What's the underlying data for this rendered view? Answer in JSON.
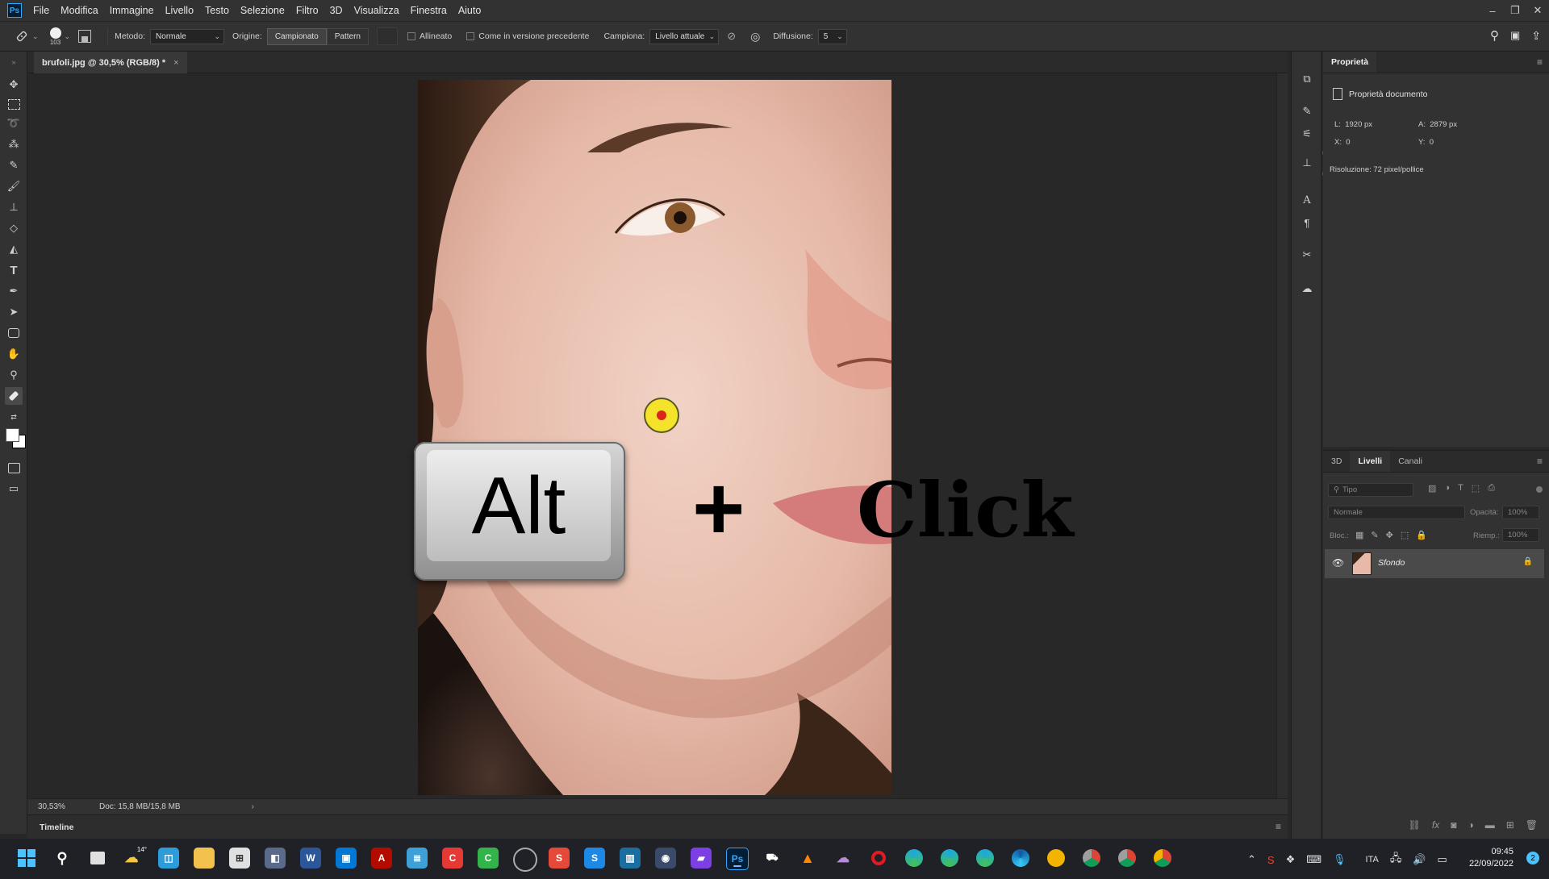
{
  "menubar": {
    "logo": "Ps",
    "items": [
      "File",
      "Modifica",
      "Immagine",
      "Livello",
      "Testo",
      "Selezione",
      "Filtro",
      "3D",
      "Visualizza",
      "Finestra",
      "Aiuto"
    ],
    "window_controls": [
      "–",
      "❐",
      "✕"
    ]
  },
  "options": {
    "brush_size": "103",
    "metodo_label": "Metodo:",
    "metodo_value": "Normale",
    "origine_label": "Origine:",
    "origine_campionato": "Campionato",
    "origine_pattern": "Pattern",
    "allineato_label": "Allineato",
    "precedente_label": "Come in versione precedente",
    "campiona_label": "Campiona:",
    "campiona_value": "Livello attuale",
    "diffusione_label": "Diffusione:",
    "diffusione_value": "5"
  },
  "document": {
    "tab_title": "brufoli.jpg @ 30,5% (RGB/8) *",
    "tab_close": "×",
    "zoom": "30,53%",
    "doc_info": "Doc: 15,8 MB/15,8 MB",
    "status_arrow": "›"
  },
  "overlay": {
    "key_label": "Alt",
    "plus": "+",
    "click_label": "Click"
  },
  "timeline": {
    "label": "Timeline"
  },
  "properties": {
    "tab": "Proprietà",
    "doc_props": "Proprietà documento",
    "width_label": "L:",
    "width_value": "1920 px",
    "height_label": "A:",
    "height_value": "2879 px",
    "x_label": "X:",
    "x_value": "0",
    "y_label": "Y:",
    "y_value": "0",
    "resolution": "Risoluzione: 72 pixel/pollice"
  },
  "layers": {
    "tabs": [
      "3D",
      "Livelli",
      "Canali"
    ],
    "active_tab": "Livelli",
    "filter_placeholder": "Tipo",
    "blend_mode": "Normale",
    "opacity_label": "Opacità:",
    "opacity_value": "100%",
    "lock_label": "Bloc.:",
    "fill_label": "Riemp.:",
    "fill_value": "100%",
    "layer_name": "Sfondo"
  },
  "taskbar": {
    "weather_temp": "14°",
    "language": "ITA",
    "time": "09:45",
    "date": "22/09/2022",
    "notif_count": "2"
  },
  "colors": {
    "accent": "#31a8ff",
    "panel_bg": "#323232",
    "canvas_bg": "#282828",
    "taskbar_bg": "#1f2126"
  }
}
